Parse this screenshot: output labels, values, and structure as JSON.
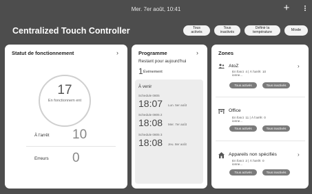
{
  "statusbar": {
    "datetime": "Mer. 7er août, 10:41"
  },
  "header": {
    "title": "Centralized Touch Controller",
    "buttons": {
      "all_on_1": "Tous",
      "all_on_2": "activés",
      "all_off_1": "Tous",
      "all_off_2": "inactivés",
      "temp_1": "Définir la",
      "temp_2": "température",
      "mode": "Mode"
    }
  },
  "status_card": {
    "title": "Statut de fonctionnement",
    "running_count": "17",
    "running_label": "En fonctionnem ent",
    "stopped_label": "À l'arrêt",
    "stopped_count": "10",
    "errors_label": "Erreurs",
    "errors_count": "0"
  },
  "program_card": {
    "title": "Programme",
    "today_label": "Restant pour aujourd'hui",
    "today_count": "1",
    "today_unit": "Événement",
    "upcoming_title": "À venir",
    "schedules": [
      {
        "name": "Schedule 0805",
        "time": "18:07",
        "date": "Lun. 5er août"
      },
      {
        "name": "Schedule 0805 2",
        "time": "18:08",
        "date": "Mer. 7er août"
      },
      {
        "name": "Schedule 0805 3",
        "time": "18:08",
        "date": "Jeu. 8er août"
      }
    ]
  },
  "zones_card": {
    "title": "Zones",
    "on_label": "Tous activés",
    "off_label": "Tous inactivés",
    "zones": [
      {
        "name": "AtoZ",
        "fonct_1": "En fonct",
        "fonct_2": "ionne...",
        "running": "4",
        "stopped_label": "À l'arrêt",
        "stopped": "10"
      },
      {
        "name": "Office",
        "fonct_1": "En fonct",
        "fonct_2": "ionne...",
        "running": "11",
        "stopped_label": "À l'arrêt",
        "stopped": "0"
      },
      {
        "name": "Appareils non spécifiés",
        "fonct_1": "En fonct",
        "fonct_2": "ionne...",
        "running": "2",
        "stopped_label": "À l'arrêt",
        "stopped": "0"
      }
    ]
  }
}
